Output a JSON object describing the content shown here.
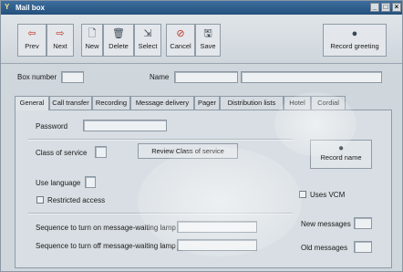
{
  "window": {
    "title": "Mail box",
    "app_icon": "Y",
    "controls": [
      "_",
      "□",
      "×"
    ]
  },
  "toolbar": {
    "buttons": [
      {
        "label": "Prev",
        "icon": "arrow-left-icon",
        "glyph": "⇦"
      },
      {
        "label": "Next",
        "icon": "arrow-right-icon",
        "glyph": "⇨"
      },
      {
        "label": "New",
        "icon": "new-document-icon",
        "glyph": "🗋"
      },
      {
        "label": "Delete",
        "icon": "trash-icon",
        "glyph": "🗑"
      },
      {
        "label": "Select",
        "icon": "select-icon",
        "glyph": "⇲"
      },
      {
        "label": "Cancel",
        "icon": "cancel-icon",
        "glyph": "⊘"
      },
      {
        "label": "Save",
        "icon": "save-icon",
        "glyph": "🖫"
      }
    ],
    "record_greeting": {
      "label": "Record greeting",
      "icon": "record-icon",
      "glyph": "●"
    }
  },
  "header_fields": {
    "box_number_label": "Box number",
    "name_label": "Name"
  },
  "tabs": [
    "General",
    "Call transfer",
    "Recording",
    "Message delivery",
    "Pager",
    "Distribution lists",
    "Hotel",
    "Cordial"
  ],
  "general": {
    "password_label": "Password",
    "class_of_service_label": "Class of service",
    "review_class_button": "Review Class of service",
    "record_name_button": "Record name",
    "use_language_label": "Use language",
    "restricted_access_label": "Restricted access",
    "uses_vcm_label": "Uses VCM",
    "lamp_on_label": "Sequence to turn on message-waiting lamp",
    "lamp_off_label": "Sequence to turn off message-waiting lamp",
    "new_messages_label": "New messages",
    "old_messages_label": "Old messages"
  },
  "colors": {
    "accent": "#24507c",
    "window_bg": "#cfd6dc"
  }
}
